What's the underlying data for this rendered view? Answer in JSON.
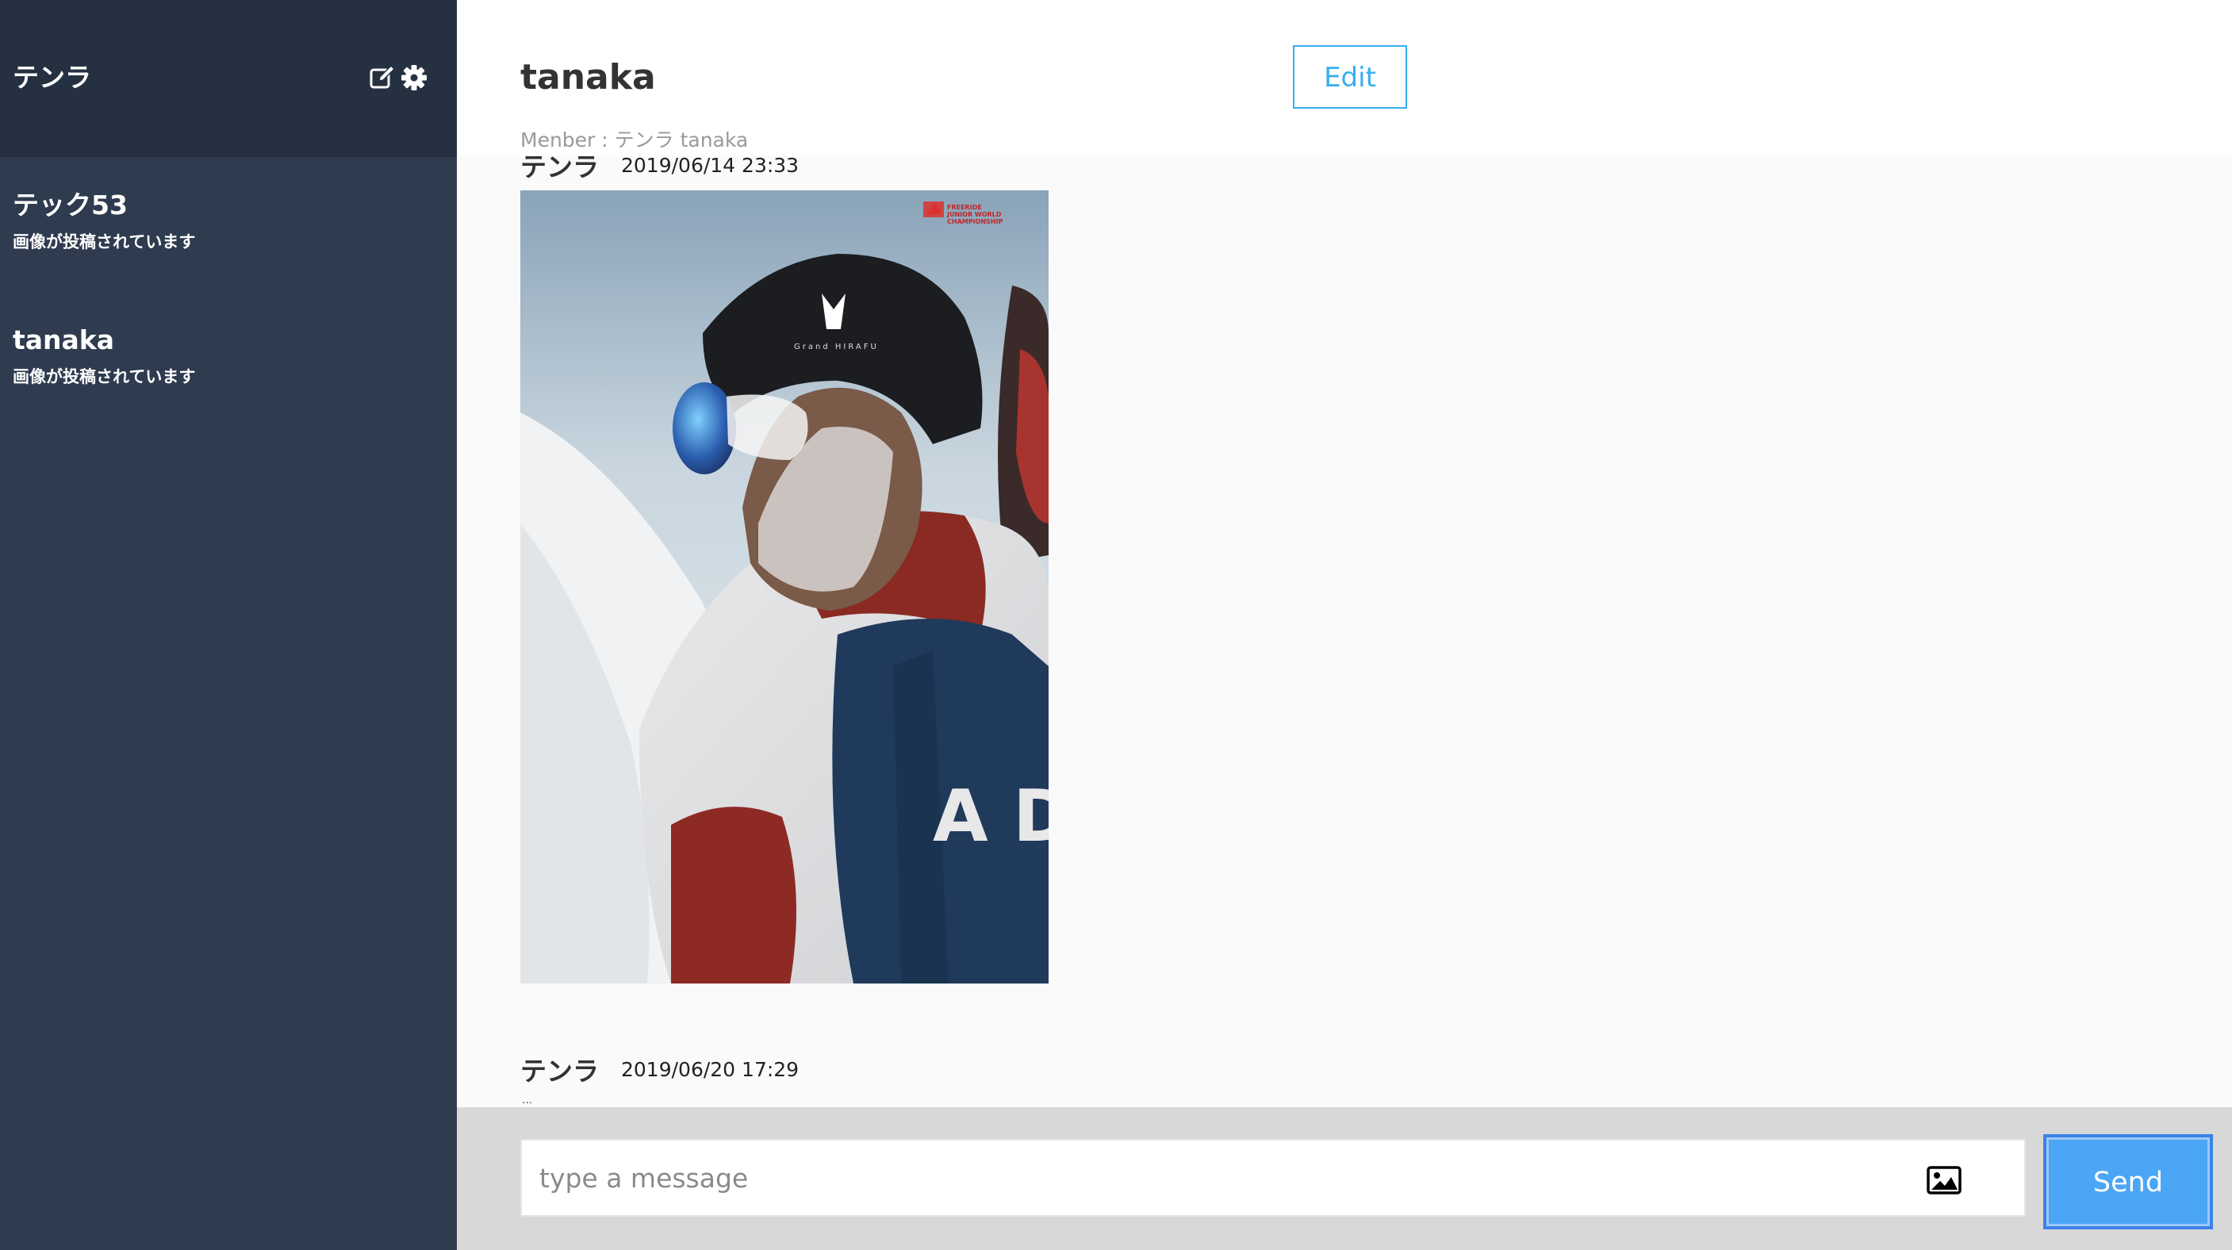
{
  "sidebar": {
    "user_name": "テンラ",
    "icons": {
      "edit": "edit-icon",
      "settings": "gear-icon"
    },
    "groups": [
      {
        "name": "テック53",
        "last_message": "画像が投稿されています"
      },
      {
        "name": "tanaka",
        "last_message": "画像が投稿されています"
      }
    ]
  },
  "header": {
    "title": "tanaka",
    "members": "Menber : テンラ tanaka",
    "edit_label": "Edit"
  },
  "messages": [
    {
      "user": "テンラ",
      "date": "2019/06/14 23:33",
      "has_image": true
    },
    {
      "user": "テンラ",
      "date": "2019/06/20 17:29",
      "text": "..."
    }
  ],
  "form": {
    "placeholder": "type a message",
    "image_icon": "image-icon",
    "send_label": "Send"
  },
  "colors": {
    "sidebar_bg": "#2f3b4f",
    "sidebar_header_bg": "#253141",
    "accent": "#38aef0",
    "send_bg": "#4ba6f5"
  }
}
